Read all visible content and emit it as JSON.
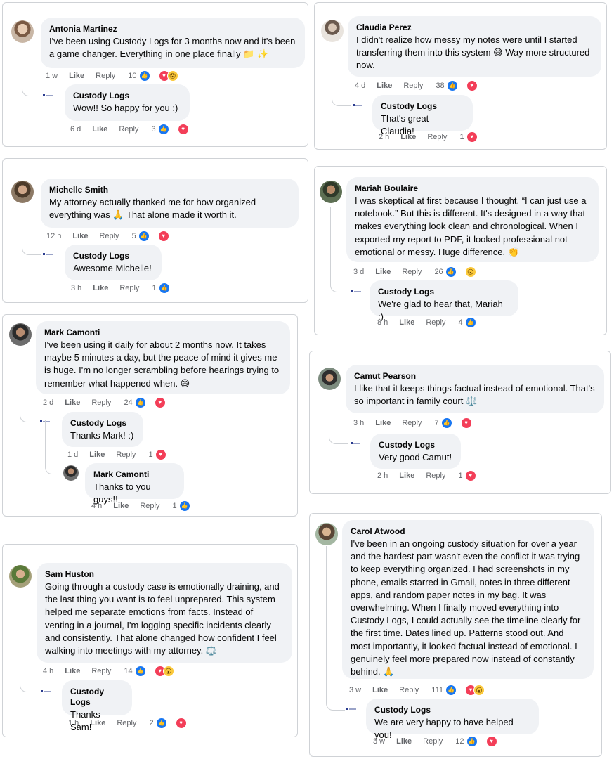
{
  "reply_label": "Reply",
  "like_label": "Like",
  "brand": {
    "name": "Custody Logs",
    "logo_icon": "custody-logs-logo-icon",
    "color": "#2a3b8f"
  },
  "colors": {
    "like": "#1877f2",
    "love": "#f33e58",
    "wow": "#fbc93b",
    "bubble": "#f0f2f5",
    "meta": "#65676b"
  },
  "cards": {
    "antonia": {
      "comment": {
        "author": "Antonia Martinez",
        "text": "I've been using Custody Logs for 3 months now and it's been a game changer. Everything in one place finally 📁 ✨",
        "time": "1 w",
        "reactions": "10",
        "reaction_icons": [
          "like",
          "love",
          "wow"
        ]
      },
      "reply": {
        "author": "Custody Logs",
        "text": "Wow!! So happy for you :)",
        "time": "6 d",
        "reactions": "3",
        "reaction_icons": [
          "like",
          "love"
        ]
      }
    },
    "claudia": {
      "comment": {
        "author": "Claudia Perez",
        "text": "I didn't realize how messy my notes were until I started transferring them into this system 😅  Way more structured now.",
        "time": "4 d",
        "reactions": "38",
        "reaction_icons": [
          "like",
          "love"
        ]
      },
      "reply": {
        "author": "Custody Logs",
        "text": "That's great Claudia!",
        "time": "2 h",
        "reactions": "1",
        "reaction_icons": [
          "love"
        ]
      }
    },
    "michelle": {
      "comment": {
        "author": "Michelle Smith",
        "text": "My attorney actually thanked me for how organized everything was 🙏  That alone made it worth it.",
        "time": "12 h",
        "reactions": "5",
        "reaction_icons": [
          "like",
          "love"
        ]
      },
      "reply": {
        "author": "Custody Logs",
        "text": "Awesome Michelle!",
        "time": "3 h",
        "reactions": "1",
        "reaction_icons": [
          "like"
        ]
      }
    },
    "mariah": {
      "comment": {
        "author": "Mariah Boulaire",
        "text": "I was skeptical at first because I thought, “I can just use a notebook.” But this is different. It's designed in a way that makes everything look clean and chronological. When I exported my report to PDF, it looked professional not emotional or messy. Huge difference. 👏",
        "time": "3 d",
        "reactions": "26",
        "reaction_icons": [
          "like",
          "wow"
        ]
      },
      "reply": {
        "author": "Custody Logs",
        "text": "We're glad to hear that, Mariah :)",
        "time": "8 h",
        "reactions": "4",
        "reaction_icons": [
          "like"
        ]
      }
    },
    "mark": {
      "comment": {
        "author": "Mark Camonti",
        "text": "I've been using it daily for about 2 months now. It takes maybe 5 minutes a day, but the peace of mind it gives me is huge. I'm no longer scrambling before hearings trying to remember what happened when. 😅",
        "time": "2 d",
        "reactions": "24",
        "reaction_icons": [
          "like",
          "love"
        ]
      },
      "reply": {
        "author": "Custody Logs",
        "text": "Thanks Mark! :)",
        "time": "1 d",
        "reactions": "1",
        "reaction_icons": [
          "love"
        ]
      },
      "reply2": {
        "author": "Mark Camonti",
        "text": "Thanks to you guys!!",
        "time": "4 h",
        "reactions": "1",
        "reaction_icons": [
          "like"
        ]
      }
    },
    "camut": {
      "comment": {
        "author": "Camut Pearson",
        "text": "I like that it keeps things factual instead of emotional. That's so important in family court ⚖️",
        "time": "3 h",
        "reactions": "7",
        "reaction_icons": [
          "like",
          "love"
        ]
      },
      "reply": {
        "author": "Custody Logs",
        "text": "Very good Camut!",
        "time": "2 h",
        "reactions": "1",
        "reaction_icons": [
          "love"
        ]
      }
    },
    "sam": {
      "comment": {
        "author": "Sam Huston",
        "text": "Going through a custody case is emotionally draining, and the last thing you want is to feel unprepared. This system helped me separate emotions from facts. Instead of venting in a journal, I'm logging specific incidents clearly and consistently. That alone changed how confident I feel walking into meetings with my attorney. ⚖️",
        "time": "4 h",
        "reactions": "14",
        "reaction_icons": [
          "like",
          "love",
          "wow"
        ]
      },
      "reply": {
        "author": "Custody Logs",
        "text": "Thanks Sam!",
        "time": "1 h",
        "reactions": "2",
        "reaction_icons": [
          "like",
          "love"
        ]
      }
    },
    "carol": {
      "comment": {
        "author": "Carol Atwood",
        "text": "I've been in an ongoing custody situation for over a year and the hardest part wasn't even the conflict it was trying to keep everything organized. I had screenshots in my phone, emails starred in Gmail, notes in three different apps, and random paper notes in my bag. It was overwhelming. When I finally moved everything into Custody Logs, I could actually see the timeline clearly for the first time. Dates lined up. Patterns stood out. And most importantly, it looked factual instead of emotional. I genuinely feel more prepared now instead of constantly behind. 🙏",
        "time": "3 w",
        "reactions": "111",
        "reaction_icons": [
          "like",
          "love",
          "wow"
        ]
      },
      "reply": {
        "author": "Custody Logs",
        "text": "We are very happy to have helped you!",
        "time": "3 w",
        "reactions": "12",
        "reaction_icons": [
          "like",
          "love"
        ]
      }
    }
  }
}
